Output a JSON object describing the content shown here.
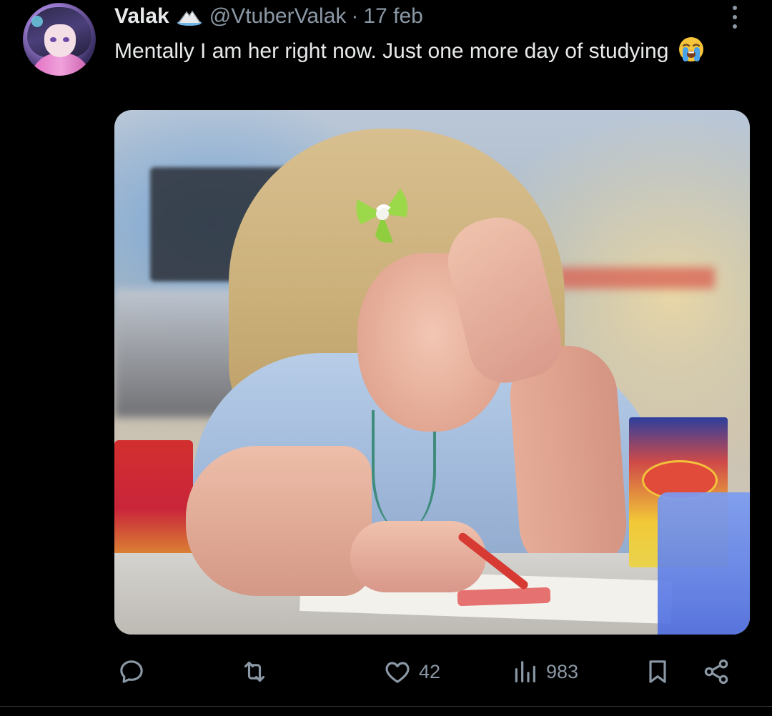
{
  "author": {
    "display_name": "Valak",
    "handle": "@VtuberValak",
    "separator": "·",
    "date": "17 feb"
  },
  "tweet": {
    "text": "Mentally I am her right now. Just one more day of studying",
    "emoji": "loudly-crying-face"
  },
  "media": {
    "type": "photo",
    "subject": "crying child drawing with a red crayon"
  },
  "actions": {
    "reply_count": "",
    "retweet_count": "",
    "like_count": "42",
    "views_count": "983"
  },
  "colors": {
    "background": "#000000",
    "text_primary": "#e7e9ea",
    "text_secondary": "#8b98a5",
    "divider": "#2f3336"
  },
  "icons": [
    "more-icon",
    "verified-icon",
    "reply-icon",
    "retweet-icon",
    "like-icon",
    "views-icon",
    "bookmark-icon",
    "share-icon"
  ]
}
